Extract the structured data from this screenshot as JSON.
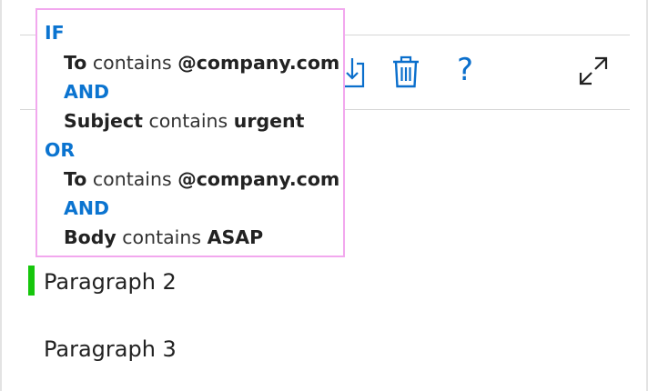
{
  "toolbar": {
    "icons": [
      "save-icon",
      "trash-icon",
      "help-icon",
      "expand-icon"
    ],
    "help_glyph": "?"
  },
  "rule": {
    "if_label": "IF",
    "and_label": "AND",
    "or_label": "OR",
    "groups": [
      {
        "conditions": [
          {
            "field": "To",
            "op": "contains",
            "value": "@company.com"
          },
          {
            "field": "Subject",
            "op": "contains",
            "value": "urgent"
          }
        ]
      },
      {
        "conditions": [
          {
            "field": "To",
            "op": "contains",
            "value": "@company.com"
          },
          {
            "field": "Body",
            "op": "contains",
            "value": "ASAP"
          }
        ]
      }
    ]
  },
  "document": {
    "paragraphs": [
      "Paragraph 2",
      "Paragraph 3"
    ]
  },
  "colors": {
    "keyword": "#0b74d0",
    "icon": "#0b6fcc",
    "popup_border": "#f2a8ee",
    "change_marker": "#16c60c"
  }
}
